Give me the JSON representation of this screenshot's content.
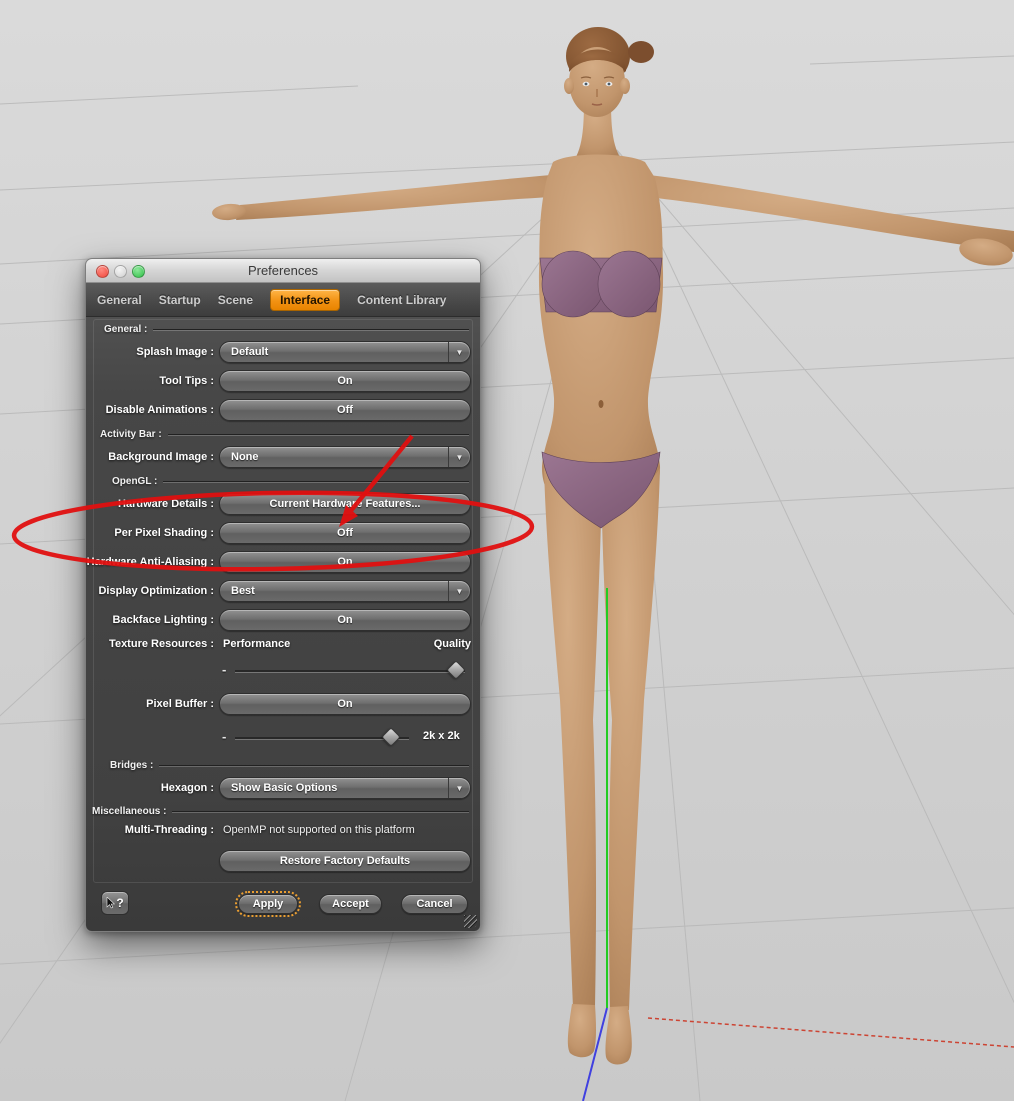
{
  "window": {
    "title": "Preferences",
    "tabs": [
      {
        "label": "General"
      },
      {
        "label": "Startup"
      },
      {
        "label": "Scene"
      },
      {
        "label": "Interface",
        "active": true
      },
      {
        "label": "Content Library"
      }
    ],
    "sections": {
      "general": "General :",
      "activity_bar": "Activity Bar :",
      "opengl": "OpenGL :",
      "bridges": "Bridges :",
      "miscellaneous": "Miscellaneous :"
    },
    "fields": {
      "splash_image": {
        "label": "Splash Image :",
        "value": "Default",
        "type": "dropdown"
      },
      "tool_tips": {
        "label": "Tool Tips :",
        "value": "On",
        "type": "toggle-button"
      },
      "disable_animations": {
        "label": "Disable Animations :",
        "value": "Off",
        "type": "toggle-button"
      },
      "background_image": {
        "label": "Background Image :",
        "value": "None",
        "type": "dropdown"
      },
      "hardware_details": {
        "label": "Hardware Details :",
        "value": "Current Hardware Features...",
        "type": "button"
      },
      "per_pixel_shading": {
        "label": "Per Pixel Shading :",
        "value": "Off",
        "type": "toggle-button"
      },
      "hardware_anti_aliasing": {
        "label": "Hardware Anti-Aliasing :",
        "value": "On",
        "type": "toggle-button"
      },
      "display_optimization": {
        "label": "Display Optimization :",
        "value": "Best",
        "type": "dropdown"
      },
      "backface_lighting": {
        "label": "Backface Lighting :",
        "value": "On",
        "type": "toggle-button"
      },
      "texture_resources": {
        "label": "Texture Resources :",
        "min_label": "Performance",
        "max_label": "Quality",
        "minus": "-",
        "slider_position": "max"
      },
      "pixel_buffer": {
        "label": "Pixel Buffer :",
        "value": "On",
        "type": "toggle-button"
      },
      "pixel_buffer_size": {
        "minus": "-",
        "value": "2k x 2k"
      },
      "hexagon": {
        "label": "Hexagon :",
        "value": "Show Basic Options",
        "type": "dropdown"
      },
      "multi_threading": {
        "label": "Multi-Threading :",
        "value": "OpenMP not supported on this platform"
      }
    },
    "buttons": {
      "restore_defaults": "Restore Factory Defaults",
      "whats_this": "?",
      "apply": "Apply",
      "accept": "Accept",
      "cancel": "Cancel"
    }
  },
  "icons": {
    "dropdown_arrow": "▼"
  },
  "annotation": {
    "type": "ellipse-with-arrow",
    "color": "#e01010",
    "highlights": "Per Pixel Shading : Off"
  },
  "colors": {
    "tab_active_orange": "#f29213",
    "dialog_gray": "#474747",
    "axis_green": "#22cc22",
    "axis_blue": "#4040e0",
    "axis_red": "#cc4433",
    "underwear_purple": "#8f6b85",
    "skin": "#c49a76"
  }
}
